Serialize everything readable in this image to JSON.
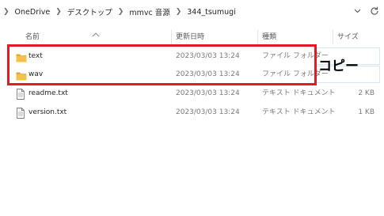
{
  "breadcrumb": {
    "items": [
      "OneDrive",
      "デスクトップ",
      "mmvc 音源",
      "344_tsumugi"
    ]
  },
  "columns": {
    "name": "名前",
    "modified": "更新日時",
    "type": "種類",
    "size": "サイズ"
  },
  "files": [
    {
      "name": "text",
      "modified": "2023/03/03 13:24",
      "type": "ファイル フォルダー",
      "size": "",
      "kind": "folder"
    },
    {
      "name": "wav",
      "modified": "2023/03/03 13:24",
      "type": "ファイル フォルダー",
      "size": "",
      "kind": "folder"
    },
    {
      "name": "readme.txt",
      "modified": "2023/03/03 13:24",
      "type": "テキスト ドキュメント",
      "size": "2 KB",
      "kind": "text"
    },
    {
      "name": "version.txt",
      "modified": "2023/03/03 13:24",
      "type": "テキスト ドキュメント",
      "size": "1 KB",
      "kind": "text"
    }
  ],
  "annotation": {
    "label": "コピー",
    "color": "#e01b22"
  },
  "colors": {
    "folder": "#f3c24b",
    "folder_dark": "#e0a82e",
    "highlight_border": "#d9e6f5"
  }
}
